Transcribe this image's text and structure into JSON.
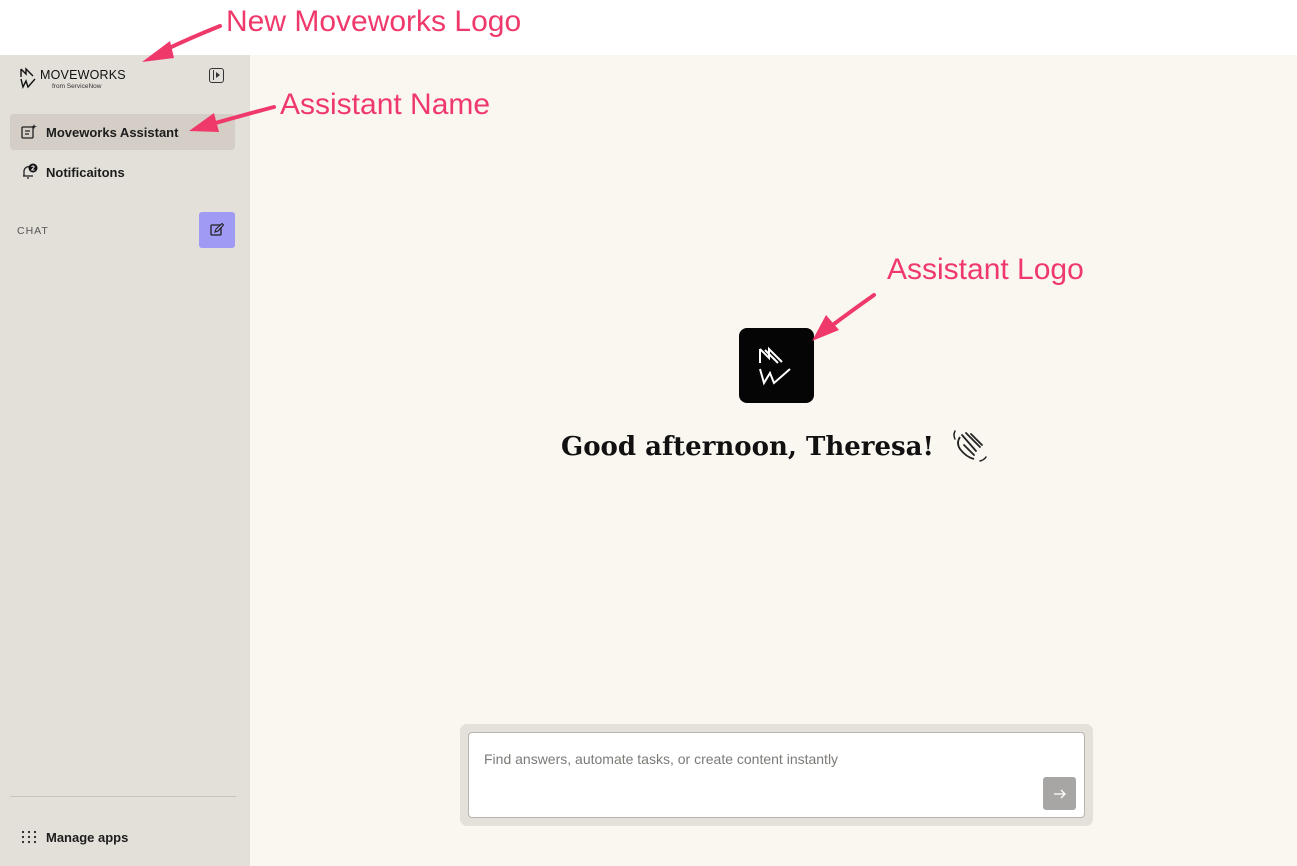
{
  "annotations": {
    "logo_callout": "New Moveworks Logo",
    "name_callout": "Assistant Name",
    "assistant_logo_callout": "Assistant Logo",
    "color": "#f0396b"
  },
  "sidebar": {
    "brand_name": "MOVEWORKS",
    "brand_sub": "from ServiceNow",
    "collapse_icon": "sidebar-collapse-icon",
    "items": [
      {
        "label": "Moveworks Assistant",
        "icon": "chat-sparkle-icon",
        "active": true
      },
      {
        "label": "Notificaitons",
        "icon": "bell-icon",
        "badge": "2",
        "active": false
      }
    ],
    "chat_section_label": "CHAT",
    "new_chat_icon": "edit-icon",
    "manage_apps_label": "Manage apps",
    "manage_apps_icon": "grid-dots-icon"
  },
  "main": {
    "greeting": "Good afternoon, Theresa!",
    "wave_icon": "waving-hand-icon",
    "composer": {
      "placeholder": "Find answers, automate tasks, or create content instantly",
      "send_icon": "arrow-right-icon"
    }
  },
  "colors": {
    "sidebar_bg": "#e3dfd9",
    "main_bg": "#faf7f1",
    "accent": "#9f9bf5",
    "active_item_bg": "#d4cec6"
  }
}
